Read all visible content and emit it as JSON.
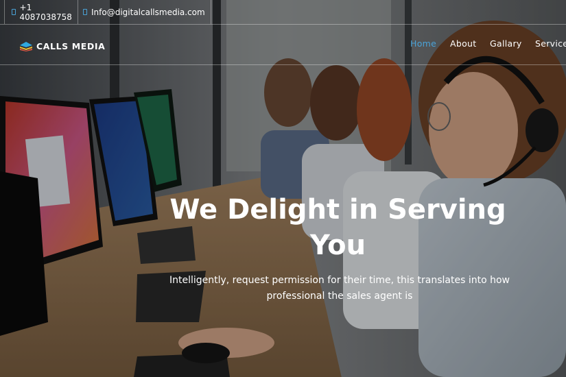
{
  "topbar": {
    "phone": "+1 4087038758",
    "email": "Info@digitalcallsmedia.com",
    "phone_icon": "phone-icon",
    "email_icon": "envelope-icon"
  },
  "brand": {
    "name": "CALLS MEDIA",
    "logo_icon": "layered-logo-icon"
  },
  "nav": {
    "items": [
      {
        "label": "Home",
        "active": true
      },
      {
        "label": "About",
        "active": false
      },
      {
        "label": "Gallary",
        "active": false
      },
      {
        "label": "Service",
        "active": false
      }
    ]
  },
  "hero": {
    "headline": "We Delight in Serving You",
    "subtitle": "Intelligently, request permission for their time, this translates into how professional the sales agent is"
  },
  "colors": {
    "accent": "#4aa3d8",
    "text": "#ffffff"
  }
}
